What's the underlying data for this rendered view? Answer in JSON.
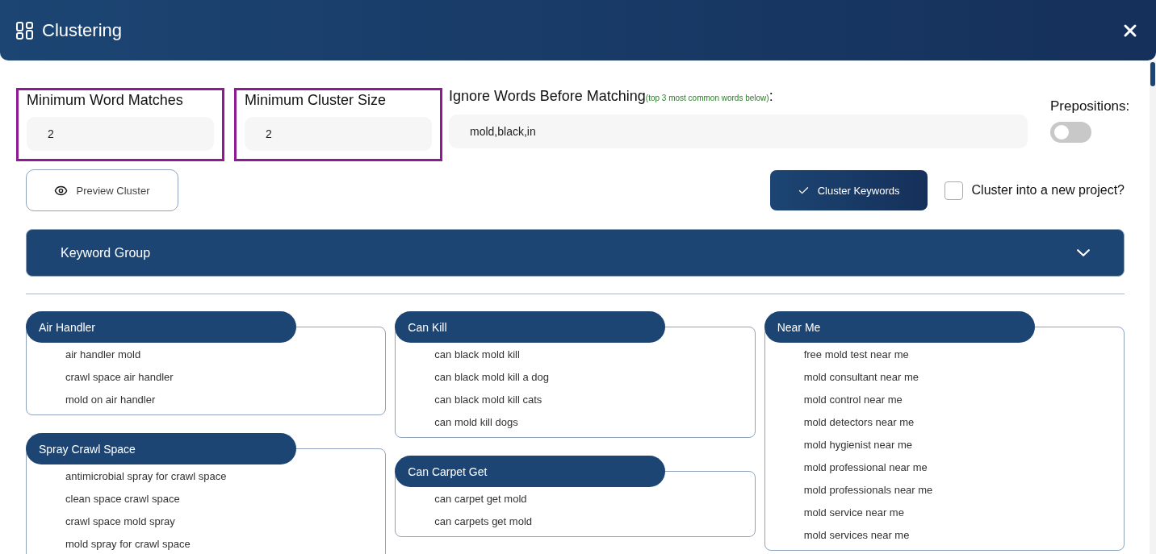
{
  "header": {
    "title": "Clustering"
  },
  "settings": {
    "fields": [
      {
        "label": "Minimum Word Matches",
        "value": "2",
        "highlighted": true
      },
      {
        "label": "Minimum Cluster Size",
        "value": "2",
        "highlighted": true
      }
    ],
    "ignore": {
      "label": "Ignore Words Before Matching",
      "hint": "(top 3 most common words below)",
      "colon": ":",
      "value": "mold,black,in"
    },
    "prepositions": {
      "label": "Prepositions:",
      "on": false
    }
  },
  "actions": {
    "preview": "Preview Cluster",
    "cluster": "Cluster Keywords",
    "new_project": {
      "label": "Cluster into a new project?",
      "checked": false
    }
  },
  "accordion": {
    "title": "Keyword Group"
  },
  "columns": [
    [
      {
        "title": "Air Handler",
        "keywords": [
          "air handler mold",
          "crawl space air handler",
          "mold on air handler"
        ]
      },
      {
        "title": "Spray Crawl Space",
        "keywords": [
          "antimicrobial spray for crawl space",
          "clean space crawl space",
          "crawl space mold spray",
          "mold spray for crawl space"
        ]
      }
    ],
    [
      {
        "title": "Can Kill",
        "keywords": [
          "can black mold kill",
          "can black mold kill a dog",
          "can black mold kill cats",
          "can mold kill dogs"
        ]
      },
      {
        "title": "Can Carpet Get",
        "keywords": [
          "can carpet get mold",
          "can carpets get mold"
        ]
      }
    ],
    [
      {
        "title": "Near Me",
        "keywords": [
          "free mold test near me",
          "mold consultant near me",
          "mold control near me",
          "mold detectors near me",
          "mold hygienist near me",
          "mold professional near me",
          "mold professionals near me",
          "mold service near me",
          "mold services near me"
        ]
      }
    ]
  ]
}
